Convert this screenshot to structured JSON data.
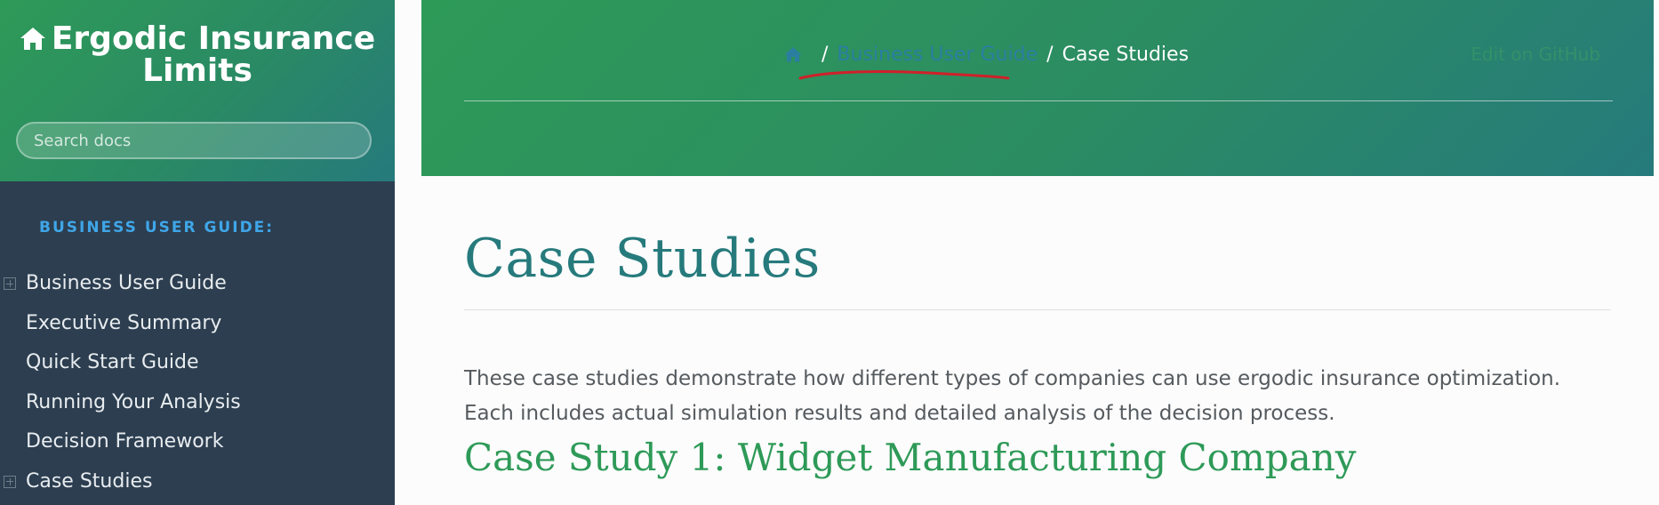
{
  "sidebar": {
    "brand": "Ergodic Insurance Limits",
    "search_placeholder": "Search docs",
    "caption": "BUSINESS USER GUIDE:",
    "items": [
      {
        "label": "Business User Guide",
        "expandable": true
      },
      {
        "label": "Executive Summary",
        "expandable": false
      },
      {
        "label": "Quick Start Guide",
        "expandable": false
      },
      {
        "label": "Running Your Analysis",
        "expandable": false
      },
      {
        "label": "Decision Framework",
        "expandable": false
      },
      {
        "label": "Case Studies",
        "expandable": true
      }
    ]
  },
  "header": {
    "breadcrumb": {
      "separator": "/",
      "parent": "Business User Guide",
      "current": "Case Studies"
    },
    "edit_link": "Edit on GitHub",
    "annotation_color": "#d0202a"
  },
  "main": {
    "title": "Case Studies",
    "intro": "These case studies demonstrate how different types of companies can use ergodic insurance optimization. Each includes actual simulation results and detailed analysis of the decision process.",
    "section_heading": "Case Study 1: Widget Manufacturing Company"
  },
  "colors": {
    "sidebar_bg": "#2c3e50",
    "accent_green": "#2e9a58",
    "accent_teal": "#267a7c",
    "caption_blue": "#3fa6e8"
  }
}
